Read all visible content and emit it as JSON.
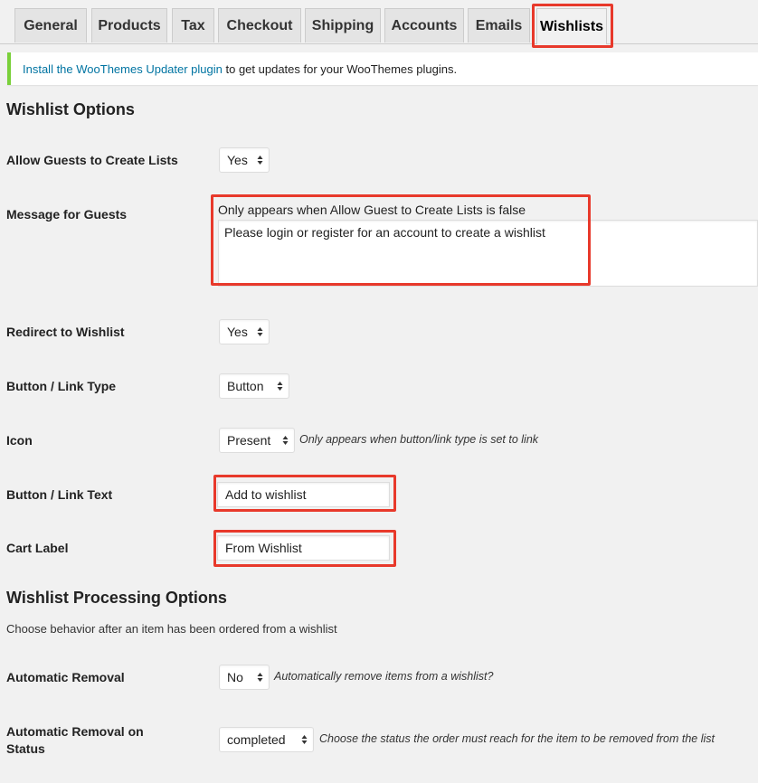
{
  "tabs": [
    "General",
    "Products",
    "Tax",
    "Checkout",
    "Shipping",
    "Accounts",
    "Emails",
    "Wishlists"
  ],
  "notice": {
    "link_text": "Install the WooThemes Updater plugin",
    "rest_text": " to get updates for your WooThemes plugins."
  },
  "wishlist_options": {
    "heading": "Wishlist Options",
    "allow_guests": {
      "label": "Allow Guests to Create Lists",
      "value": "Yes"
    },
    "guest_message": {
      "label": "Message for Guests",
      "description": "Only appears when Allow Guest to Create Lists is false",
      "value": "Please login or register for an account to create a wishlist"
    },
    "redirect": {
      "label": "Redirect to Wishlist",
      "value": "Yes"
    },
    "button_type": {
      "label": "Button / Link Type",
      "value": "Button"
    },
    "icon": {
      "label": "Icon",
      "value": "Present",
      "description": "Only appears when button/link type is set to link"
    },
    "button_text": {
      "label": "Button / Link Text",
      "value": "Add to wishlist"
    },
    "cart_label": {
      "label": "Cart Label",
      "value": "From Wishlist"
    }
  },
  "processing_options": {
    "heading": "Wishlist Processing Options",
    "subtext": "Choose behavior after an item has been ordered from a wishlist",
    "auto_removal": {
      "label": "Automatic Removal",
      "value": "No",
      "description": "Automatically remove items from a wishlist?"
    },
    "removal_status": {
      "label_line1": "Automatic Removal on",
      "label_line2": "Status",
      "value": "completed",
      "description": "Choose the status the order must reach for the item to be removed from the list"
    }
  },
  "colors": {
    "highlight": "#e8392b",
    "notice_border": "#7ad03a",
    "link": "#0074a2"
  }
}
